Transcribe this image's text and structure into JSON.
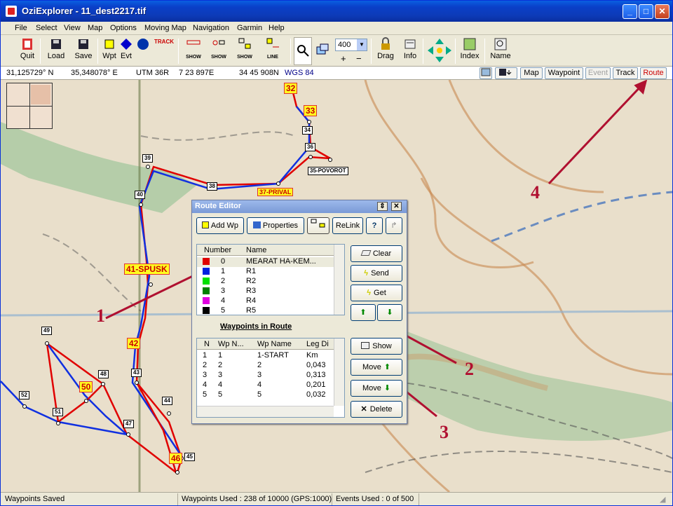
{
  "window": {
    "title": "OziExplorer - 11_dest2217.tif"
  },
  "menu": [
    "File",
    "Select",
    "View",
    "Map",
    "Options",
    "Moving Map",
    "Navigation",
    "Garmin",
    "Help"
  ],
  "toolbar": {
    "quit": "Quit",
    "load": "Load",
    "save": "Save",
    "wpt": "Wpt",
    "evt": "Evt",
    "track": "TRACK",
    "show": "SHOW",
    "line": "LINE",
    "zoom": "400",
    "drag": "Drag",
    "info": "Info",
    "index": "Index",
    "name": "Name"
  },
  "coords": {
    "lat": "31,125729° N",
    "lon": "35,348078° E",
    "utm": "UTM  36R",
    "e": "7 23 897E",
    "n": "34 45 908N",
    "datum": "WGS 84"
  },
  "viewbtns": [
    "Map",
    "Waypoint",
    "Event",
    "Track",
    "Route"
  ],
  "route_editor": {
    "title": "Route Editor",
    "buttons": {
      "add": "Add Wp",
      "properties": "Properties",
      "relink": "ReLink",
      "clear": "Clear",
      "send": "Send",
      "get": "Get",
      "show": "Show",
      "moveup": "Move",
      "movedown": "Move",
      "delete": "Delete"
    },
    "routes_header": [
      "Number",
      "Name"
    ],
    "routes": [
      {
        "num": "0",
        "name": "MEARAT HA-KEM...",
        "color": "#e00000"
      },
      {
        "num": "1",
        "name": "R1",
        "color": "#0020e0"
      },
      {
        "num": "2",
        "name": "R2",
        "color": "#00e000"
      },
      {
        "num": "3",
        "name": "R3",
        "color": "#008000"
      },
      {
        "num": "4",
        "name": "R4",
        "color": "#e000e0"
      },
      {
        "num": "5",
        "name": "R5",
        "color": "#000000"
      }
    ],
    "wp_section": "Waypoints in Route",
    "wp_header": [
      "N",
      "Wp N...",
      "Wp Name",
      "Leg Di"
    ],
    "wps": [
      {
        "n": "1",
        "wpn": "1",
        "name": "1-START",
        "dist": "Km"
      },
      {
        "n": "2",
        "wpn": "2",
        "name": "2",
        "dist": "0,043"
      },
      {
        "n": "3",
        "wpn": "3",
        "name": "3",
        "dist": "0,313"
      },
      {
        "n": "4",
        "wpn": "4",
        "name": "4",
        "dist": "0,201"
      },
      {
        "n": "5",
        "wpn": "5",
        "name": "5",
        "dist": "0,032"
      }
    ]
  },
  "map_labels": {
    "w32": "32",
    "w33": "33",
    "w34": "34",
    "w36": "36",
    "w35": "35-POVOROT",
    "w39": "39",
    "w38": "38",
    "w37": "37-PRIVAL",
    "w40": "40",
    "w41": "41-SPUSK",
    "w42": "42",
    "w43": "43",
    "w44": "44",
    "w45": "45",
    "w46": "46",
    "w47": "47",
    "w48": "48",
    "w49": "49",
    "w50": "50",
    "w51": "51",
    "w52": "52"
  },
  "annotations": [
    "1",
    "2",
    "3",
    "4"
  ],
  "statusbar": {
    "left": "Waypoints Saved",
    "used": "Waypoints Used : 238 of 10000  (GPS:1000)",
    "events": "Events Used : 0 of 500"
  }
}
